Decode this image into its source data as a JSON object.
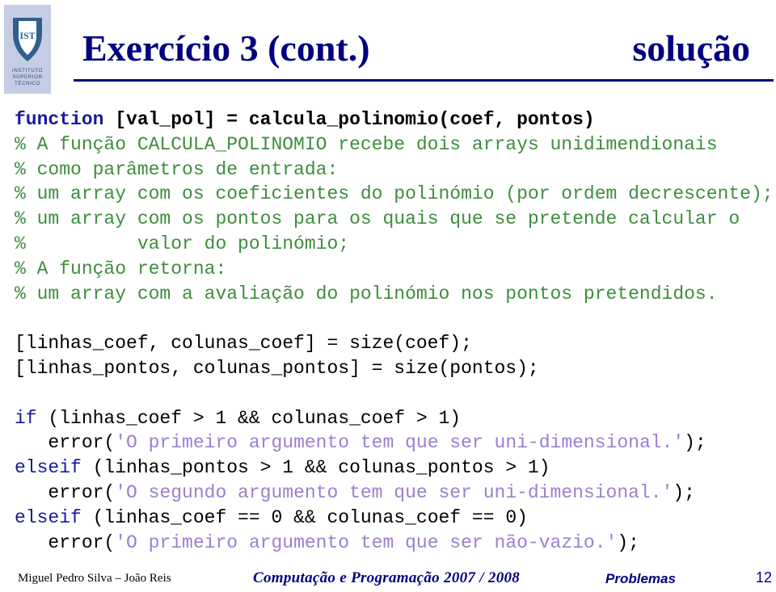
{
  "logo": {
    "monogram": "IST",
    "lines": [
      "INSTITUTO",
      "SUPERIOR",
      "TÉCNICO"
    ]
  },
  "header": {
    "title": "Exercício 3 (cont.)",
    "subtitle": "solução"
  },
  "code": {
    "lines": [
      [
        {
          "t": "function",
          "c": "kw bold"
        },
        {
          "t": " [val_pol] = calcula_polinomio(coef, pontos)",
          "c": "bold"
        }
      ],
      [
        {
          "t": "% A função CALCULA_POLINOMIO recebe dois arrays unidimendionais",
          "c": "cm"
        }
      ],
      [
        {
          "t": "% como parâmetros de entrada:",
          "c": "cm"
        }
      ],
      [
        {
          "t": "% um array com os coeficientes do polinómio (por ordem decrescente);",
          "c": "cm"
        }
      ],
      [
        {
          "t": "% um array com os pontos para os quais que se pretende calcular o",
          "c": "cm"
        }
      ],
      [
        {
          "t": "%          valor do polinómio;",
          "c": "cm"
        }
      ],
      [
        {
          "t": "% A função retorna:",
          "c": "cm"
        }
      ],
      [
        {
          "t": "% um array com a avaliação do polinómio nos pontos pretendidos.",
          "c": "cm"
        }
      ],
      [],
      [
        {
          "t": "[linhas_coef, colunas_coef] = size(coef);",
          "c": ""
        }
      ],
      [
        {
          "t": "[linhas_pontos, colunas_pontos] = size(pontos);",
          "c": ""
        }
      ],
      [],
      [
        {
          "t": "if",
          "c": "kw"
        },
        {
          "t": " (linhas_coef > 1 && colunas_coef > 1)",
          "c": ""
        }
      ],
      [
        {
          "t": "   error(",
          "c": ""
        },
        {
          "t": "'O primeiro argumento tem que ser uni-dimensional.'",
          "c": "st"
        },
        {
          "t": ");",
          "c": ""
        }
      ],
      [
        {
          "t": "elseif",
          "c": "kw"
        },
        {
          "t": " (linhas_pontos > 1 && colunas_pontos > 1)",
          "c": ""
        }
      ],
      [
        {
          "t": "   error(",
          "c": ""
        },
        {
          "t": "'O segundo argumento tem que ser uni-dimensional.'",
          "c": "st"
        },
        {
          "t": ");",
          "c": ""
        }
      ],
      [
        {
          "t": "elseif",
          "c": "kw"
        },
        {
          "t": " (linhas_coef == 0 && colunas_coef == 0)",
          "c": ""
        }
      ],
      [
        {
          "t": "   error(",
          "c": ""
        },
        {
          "t": "'O primeiro argumento tem que ser não-vazio.'",
          "c": "st"
        },
        {
          "t": ");",
          "c": ""
        }
      ]
    ]
  },
  "footer": {
    "authors": "Miguel  Pedro Silva – João Reis",
    "course": "Computação e Programação 2007 / 2008",
    "section": "Problemas",
    "page": "12"
  },
  "colors": {
    "title": "#000080",
    "keyword": "#1a1aa0",
    "comment": "#3f8c3f",
    "string": "#9b7fd0"
  }
}
